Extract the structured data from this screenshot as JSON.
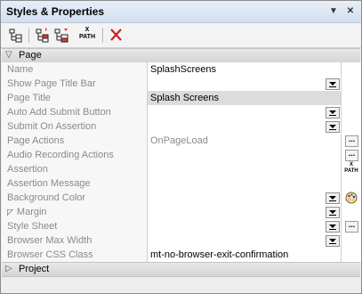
{
  "window": {
    "title": "Styles & Properties",
    "pin_glyph": "▼",
    "close_glyph": "✕"
  },
  "toolbar": {
    "buttons": [
      {
        "name": "tree-view-icon"
      },
      {
        "name": "add-style-icon"
      },
      {
        "name": "add-style-alt-icon"
      },
      {
        "name": "xpath-icon",
        "label": "X\nPATH"
      },
      {
        "name": "delete-icon",
        "color": "#cc1f1f"
      }
    ]
  },
  "groups": {
    "page": {
      "label": "Page",
      "toggle": "▽"
    },
    "project": {
      "label": "Project",
      "toggle": "▷"
    }
  },
  "rows": [
    {
      "name": "Name",
      "value": "SplashScreens",
      "name_dark": false,
      "value_gray": false,
      "dropdown": false,
      "extra": ""
    },
    {
      "name": "Show Page Title Bar",
      "value": "",
      "dropdown": true,
      "extra": ""
    },
    {
      "name": "Page Title",
      "value": "Splash Screens",
      "highlight": true,
      "dropdown": false,
      "extra": ""
    },
    {
      "name": "Auto Add Submit Button",
      "value": "",
      "dropdown": true,
      "extra": ""
    },
    {
      "name": "Submit On Assertion",
      "value": "",
      "dropdown": true,
      "extra": ""
    },
    {
      "name": "Page Actions",
      "value": "OnPageLoad",
      "value_gray": true,
      "dropdown": false,
      "extra": "dots"
    },
    {
      "name": "Audio Recording Actions",
      "value": "",
      "dropdown": false,
      "extra": "dots"
    },
    {
      "name": "Assertion",
      "value": "",
      "dropdown": false,
      "extra": "xpath"
    },
    {
      "name": "Assertion Message",
      "value": "",
      "dropdown": false,
      "extra": ""
    },
    {
      "name": "Background Color",
      "value": "",
      "dropdown": true,
      "extra": "palette"
    },
    {
      "name": "Margin",
      "value": "",
      "expander": "◸",
      "dropdown": true,
      "extra": ""
    },
    {
      "name": "Style Sheet",
      "value": "",
      "dropdown": true,
      "extra": "dots"
    },
    {
      "name": "Browser Max Width",
      "value": "",
      "dropdown": true,
      "extra": ""
    },
    {
      "name": "Browser CSS Class",
      "value": "mt-no-browser-exit-confirmation",
      "dropdown": false,
      "extra": ""
    }
  ],
  "extras": {
    "dots": "...",
    "xpath": "X\nPATH"
  },
  "colors": {
    "delete": "#cc1f1f",
    "header_bg": "#dce6f4"
  }
}
